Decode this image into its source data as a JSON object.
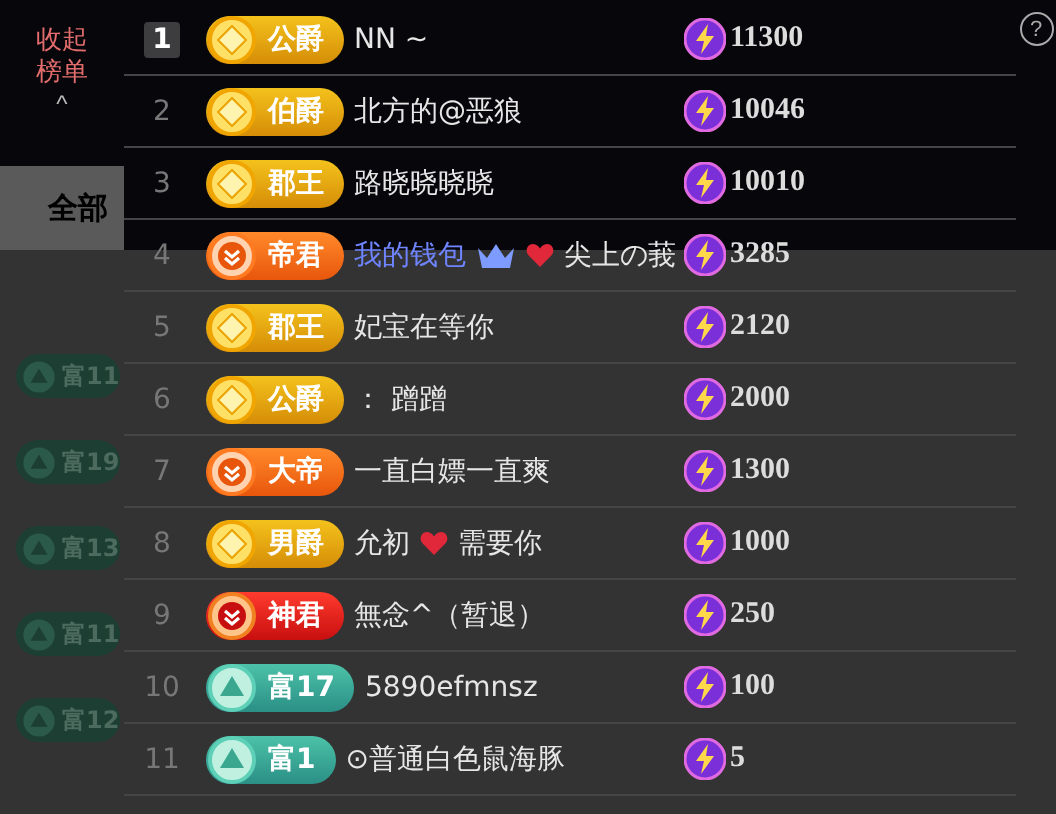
{
  "collapse_button": {
    "label": "收起榜单",
    "caret": "^"
  },
  "help_button": {
    "label": "?"
  },
  "background": {
    "tab": {
      "label": "全部",
      "selected": true
    },
    "wealth_badges": [
      {
        "label": "富11"
      },
      {
        "label": "富19"
      },
      {
        "label": "富13"
      },
      {
        "label": "富11"
      },
      {
        "label": "富12"
      }
    ]
  },
  "ranking": [
    {
      "rank": "1",
      "top": true,
      "badge": {
        "kind": "gold",
        "label": "公爵"
      },
      "name": [
        {
          "kind": "text",
          "text": "NN ~",
          "highlighted": false
        }
      ],
      "score": "11300"
    },
    {
      "rank": "2",
      "top": false,
      "badge": {
        "kind": "gold",
        "label": "伯爵"
      },
      "name": [
        {
          "kind": "text",
          "text": "北方的@恶狼",
          "highlighted": false
        }
      ],
      "score": "10046"
    },
    {
      "rank": "3",
      "top": false,
      "badge": {
        "kind": "gold",
        "label": "郡王"
      },
      "name": [
        {
          "kind": "text",
          "text": "路晓晓晓晓",
          "highlighted": false
        }
      ],
      "score": "10010"
    },
    {
      "rank": "4",
      "top": false,
      "badge": {
        "kind": "orange",
        "label": "帝君"
      },
      "name": [
        {
          "kind": "text",
          "text": "我的钱包",
          "highlighted": true
        },
        {
          "kind": "crown"
        },
        {
          "kind": "heart"
        },
        {
          "kind": "text",
          "text": "尖上の莪",
          "highlighted": false
        }
      ],
      "score": "3285"
    },
    {
      "rank": "5",
      "top": false,
      "badge": {
        "kind": "gold",
        "label": "郡王"
      },
      "name": [
        {
          "kind": "text",
          "text": "妃宝在等你",
          "highlighted": false
        }
      ],
      "score": "2120"
    },
    {
      "rank": "6",
      "top": false,
      "badge": {
        "kind": "gold",
        "label": "公爵"
      },
      "name": [
        {
          "kind": "text",
          "text": "： 蹭蹭",
          "highlighted": false
        }
      ],
      "score": "2000"
    },
    {
      "rank": "7",
      "top": false,
      "badge": {
        "kind": "orange",
        "label": "大帝"
      },
      "name": [
        {
          "kind": "text",
          "text": "一直白嫖一直爽",
          "highlighted": false
        }
      ],
      "score": "1300"
    },
    {
      "rank": "8",
      "top": false,
      "badge": {
        "kind": "gold",
        "label": "男爵"
      },
      "name": [
        {
          "kind": "text",
          "text": "允初",
          "highlighted": false
        },
        {
          "kind": "heart"
        },
        {
          "kind": "text",
          "text": "需要你",
          "highlighted": false
        }
      ],
      "score": "1000"
    },
    {
      "rank": "9",
      "top": false,
      "badge": {
        "kind": "red",
        "label": "神君"
      },
      "name": [
        {
          "kind": "text",
          "text": "無念^（暂退）",
          "highlighted": false
        }
      ],
      "score": "250"
    },
    {
      "rank": "10",
      "top": false,
      "badge": {
        "kind": "teal",
        "label": "富17"
      },
      "name": [
        {
          "kind": "text",
          "text": "5890efmnsz",
          "highlighted": false
        }
      ],
      "score": "100"
    },
    {
      "rank": "11",
      "top": false,
      "badge": {
        "kind": "teal",
        "label": "富1"
      },
      "name": [
        {
          "kind": "text",
          "text": "⊙普通白色鼠海豚",
          "highlighted": false
        }
      ],
      "score": "5"
    }
  ]
}
